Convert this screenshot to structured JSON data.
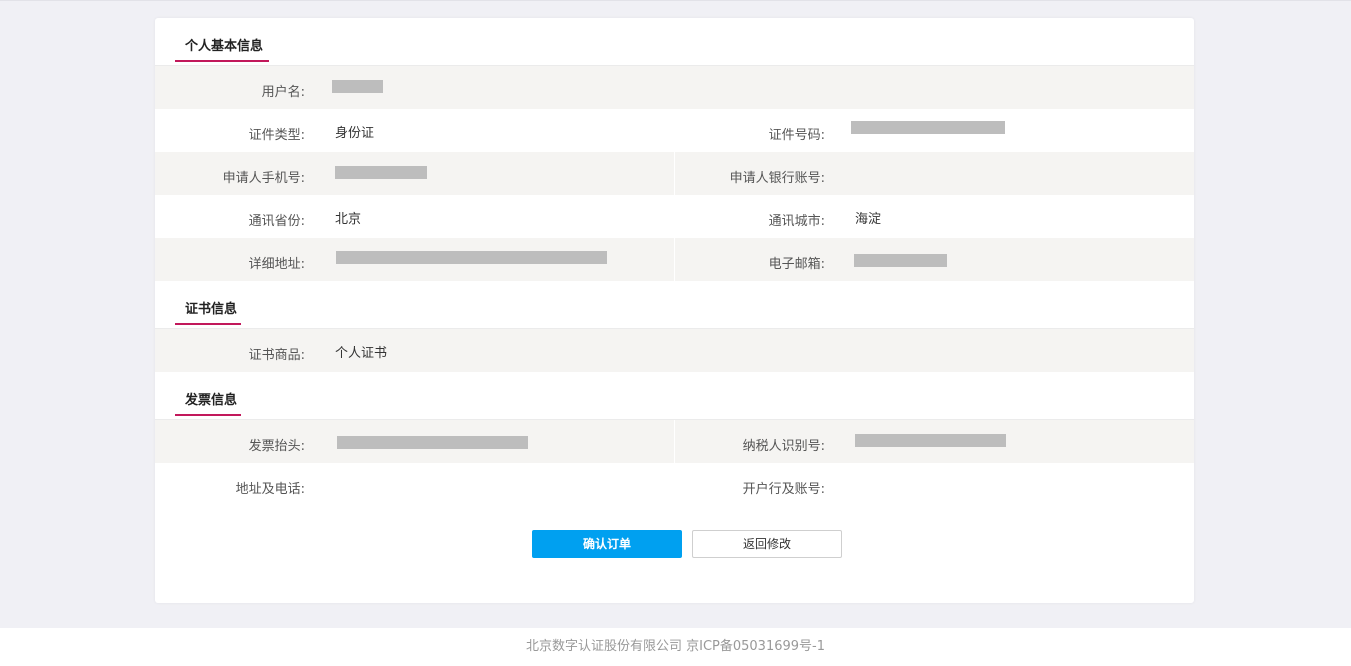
{
  "sections": {
    "personal": {
      "title": "个人基本信息",
      "username_label": "用户名:",
      "id_type_label": "证件类型:",
      "id_type_value": "身份证",
      "id_number_label": "证件号码:",
      "phone_label": "申请人手机号:",
      "bank_account_label": "申请人银行账号:",
      "province_label": "通讯省份:",
      "province_value": "北京",
      "city_label": "通讯城市:",
      "city_value": "海淀",
      "address_label": "详细地址:",
      "email_label": "电子邮箱:"
    },
    "certificate": {
      "title": "证书信息",
      "product_label": "证书商品:",
      "product_value": "个人证书"
    },
    "invoice": {
      "title": "发票信息",
      "header_label": "发票抬头:",
      "taxpayer_id_label": "纳税人识别号:",
      "address_phone_label": "地址及电话:",
      "bank_label": "开户行及账号:"
    }
  },
  "actions": {
    "confirm_label": "确认订单",
    "back_label": "返回修改"
  },
  "footer": {
    "text": "北京数字认证股份有限公司 京ICP备05031699号-1"
  },
  "colors": {
    "accent_underline": "#c2185b",
    "primary_button": "#00a0f0",
    "row_gray": "#f5f4f2"
  }
}
